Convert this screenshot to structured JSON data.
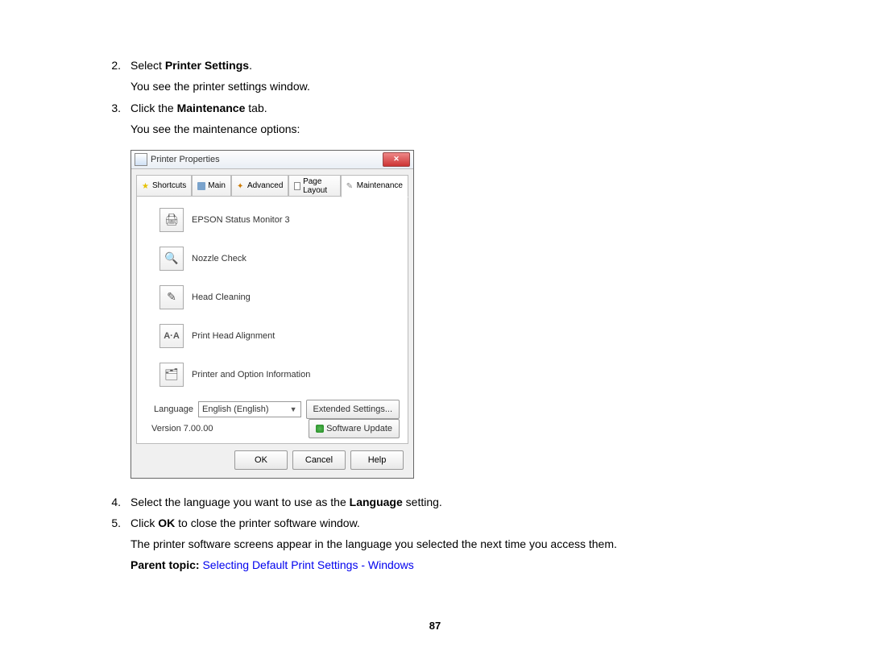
{
  "steps": {
    "s2_num": "2.",
    "s2_a": "Select ",
    "s2_b": "Printer Settings",
    "s2_c": ".",
    "s2_sub": "You see the printer settings window.",
    "s3_num": "3.",
    "s3_a": "Click the ",
    "s3_b": "Maintenance",
    "s3_c": " tab.",
    "s3_sub": "You see the maintenance options:",
    "s4_num": "4.",
    "s4_a": "Select the language you want to use as the ",
    "s4_b": "Language",
    "s4_c": " setting.",
    "s5_num": "5.",
    "s5_a": "Click ",
    "s5_b": "OK",
    "s5_c": " to close the printer software window."
  },
  "tail_text": "The printer software screens appear in the language you selected the next time you access them.",
  "parent_topic_label": "Parent topic: ",
  "parent_topic_link": "Selecting Default Print Settings - Windows",
  "page_number": "87",
  "win": {
    "title": "Printer Properties",
    "close_glyph": "✕",
    "tabs": {
      "shortcuts": "Shortcuts",
      "main": "Main",
      "advanced": "Advanced",
      "page_layout": "Page Layout",
      "maintenance": "Maintenance"
    },
    "items": {
      "status": "EPSON Status Monitor 3",
      "nozzle": "Nozzle Check",
      "head_clean": "Head Cleaning",
      "head_align": "Print Head Alignment",
      "printer_info": "Printer and Option Information"
    },
    "icons": {
      "status": "🖨",
      "nozzle": "🔍",
      "head_clean": "✎",
      "head_align": "A·A",
      "printer_info": "🗂"
    },
    "language_label": "Language",
    "language_value": "English (English)",
    "extended_btn": "Extended Settings...",
    "version_label": "Version 7.00.00",
    "software_update_btn": "Software Update",
    "ok": "OK",
    "cancel": "Cancel",
    "help": "Help"
  }
}
